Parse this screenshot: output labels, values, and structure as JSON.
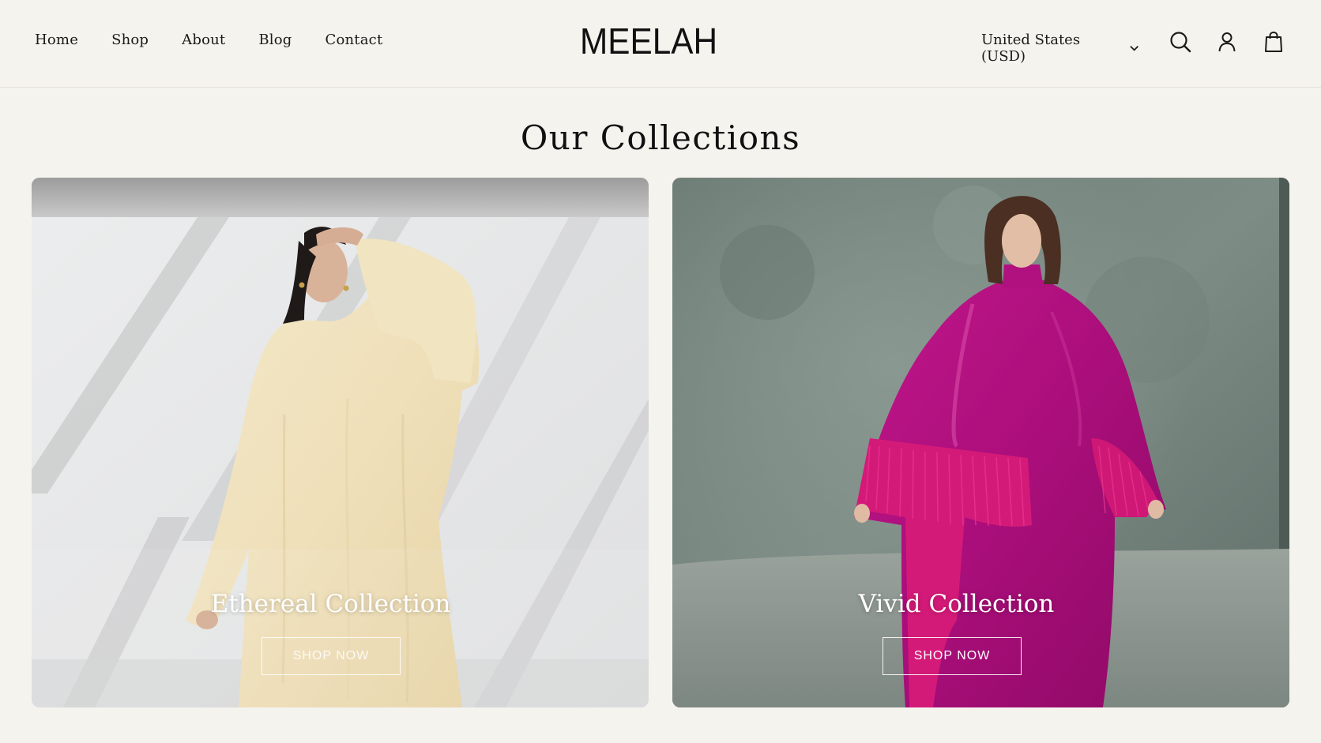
{
  "header": {
    "nav": [
      {
        "label": "Home"
      },
      {
        "label": "Shop"
      },
      {
        "label": "About"
      },
      {
        "label": "Blog"
      },
      {
        "label": "Contact"
      }
    ],
    "logo": "MEELAH",
    "currency": "United States (USD)",
    "icons": [
      "search-icon",
      "account-icon",
      "cart-icon"
    ]
  },
  "main": {
    "title": "Our Collections",
    "collections": [
      {
        "title": "Ethereal Collection",
        "button": "SHOP NOW"
      },
      {
        "title": "Vivid Collection",
        "button": "SHOP NOW"
      }
    ]
  },
  "colors": {
    "background": "#f5f3ee",
    "text": "#1c1b19",
    "ethereal_dress": "#f1e6c9",
    "vivid_dress": "#b3127f"
  }
}
